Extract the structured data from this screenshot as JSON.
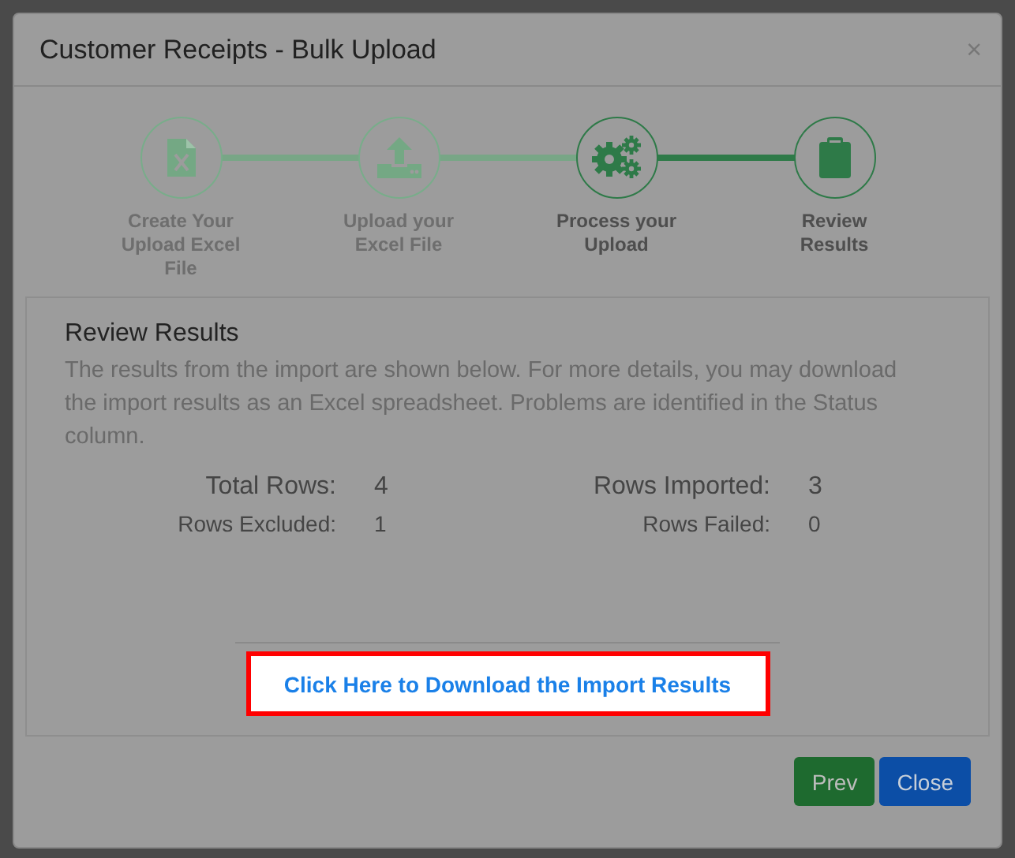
{
  "dialog": {
    "title": "Customer Receipts - Bulk Upload",
    "close_glyph": "×"
  },
  "steps": [
    {
      "kind": "excel",
      "label": "Create Your Upload Excel File",
      "active": false
    },
    {
      "kind": "upload",
      "label": "Upload your Excel File",
      "active": false
    },
    {
      "kind": "gears",
      "label": "Process your Upload",
      "active": true
    },
    {
      "kind": "clipboard",
      "label": "Review Results",
      "active": true
    }
  ],
  "panel": {
    "title": "Review Results",
    "description": "The results from the import are shown below. For more details, you may download the import results as an Excel spreadsheet. Problems are identified in the Status column.",
    "stats": [
      {
        "label": "Total Rows:",
        "value": "4",
        "kind": "major"
      },
      {
        "label": "Rows Imported:",
        "value": "3",
        "kind": "major"
      },
      {
        "label": "Rows Excluded:",
        "value": "1",
        "kind": "minor"
      },
      {
        "label": "Rows Failed:",
        "value": "0",
        "kind": "minor"
      }
    ],
    "download_link": "Click Here to Download the Import Results"
  },
  "buttons": [
    {
      "label": "Prev",
      "kind": "success"
    },
    {
      "label": "Close",
      "kind": "primary"
    }
  ]
}
